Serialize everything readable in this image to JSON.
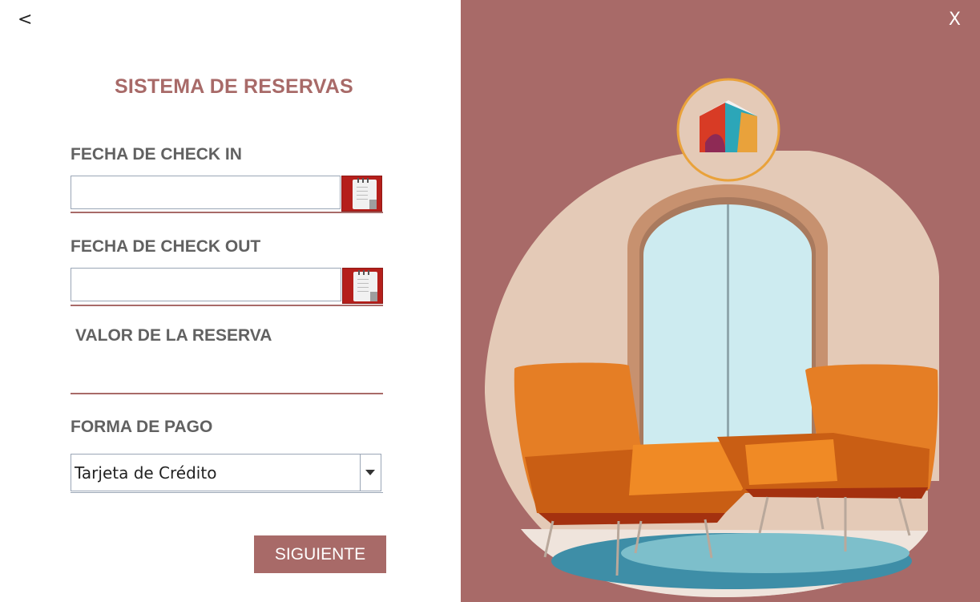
{
  "nav": {
    "back_label": "<",
    "close_label": "X"
  },
  "form": {
    "title": "SISTEMA DE RESERVAS",
    "checkin_label": "FECHA DE CHECK IN",
    "checkin_value": "",
    "checkout_label": "FECHA DE CHECK OUT",
    "checkout_value": "",
    "value_label": "VALOR DE LA RESERVA",
    "value_value": "",
    "payment_label": "FORMA DE PAGO",
    "payment_selected": "Tarjeta de Crédito",
    "next_label": "SIGUIENTE"
  },
  "icons": {
    "calendar_checkin": "calendar-icon",
    "calendar_checkout": "calendar-icon",
    "dropdown": "chevron-down-icon"
  },
  "colors": {
    "accent": "#a86a68",
    "calendar_button": "#b51f1b",
    "label_text": "#616161",
    "panel_background": "#a86a68"
  }
}
